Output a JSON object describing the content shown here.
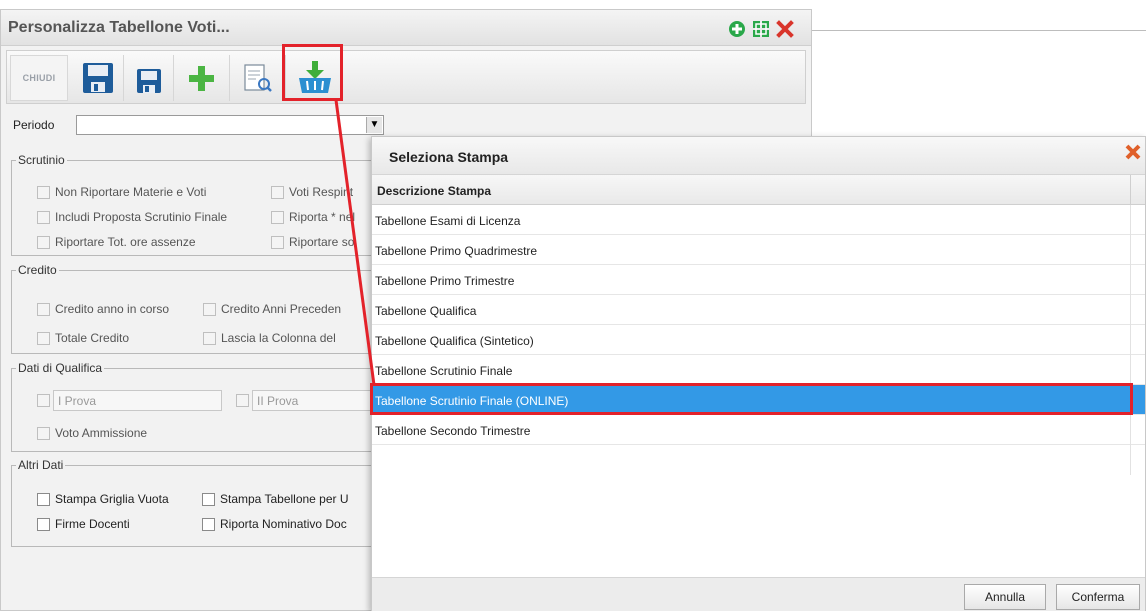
{
  "window": {
    "title": "Personalizza Tabellone Voti...",
    "header_icons": [
      "add-circle-icon",
      "fullscreen-icon",
      "close-icon"
    ]
  },
  "toolbar": {
    "close_label": "CHIUDI",
    "tools": [
      "save-icon",
      "save-small-icon",
      "add-icon",
      "print-preview-icon",
      "download-basket-icon"
    ]
  },
  "periodo": {
    "label": "Periodo",
    "value": ""
  },
  "scrutinio": {
    "legend": "Scrutinio",
    "items": [
      "Non Riportare Materie e Voti",
      "Voti Respint",
      "Includi Proposta Scrutinio Finale",
      "Riporta * nel",
      "Riportare Tot. ore assenze",
      "Riportare so"
    ]
  },
  "credito": {
    "legend": "Credito",
    "items": [
      "Credito anno in corso",
      "Credito Anni Preceden",
      "Totale Credito",
      "Lascia la Colonna del"
    ]
  },
  "qualifica": {
    "legend": "Dati di Qualifica",
    "prova1": "I Prova",
    "prova2": "II Prova",
    "voto": "Voto Ammissione"
  },
  "altri": {
    "legend": "Altri Dati",
    "items": [
      "Stampa Griglia Vuota",
      "Stampa Tabellone per U",
      "Firme Docenti",
      "Riporta Nominativo Doc"
    ]
  },
  "print_dialog": {
    "title": "Seleziona Stampa",
    "column_header": "Descrizione Stampa",
    "rows": [
      "Tabellone Esami di Licenza",
      "Tabellone Primo Quadrimestre",
      "Tabellone Primo Trimestre",
      "Tabellone Qualifica",
      "Tabellone Qualifica (Sintetico)",
      "Tabellone Scrutinio Finale",
      "Tabellone Scrutinio Finale (ONLINE)",
      "Tabellone Secondo Trimestre"
    ],
    "selected_index": 6,
    "cancel_label": "Annulla",
    "confirm_label": "Conferma"
  },
  "colors": {
    "selection": "#3399e6",
    "annotation": "#e3222a",
    "accent_green": "#2aa84a",
    "save_blue": "#1e5c9a"
  }
}
